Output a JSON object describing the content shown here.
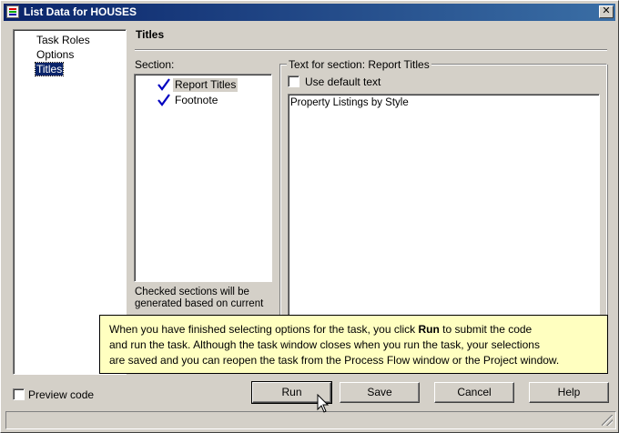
{
  "window": {
    "title": "List Data for HOUSES"
  },
  "nav": {
    "items": [
      {
        "label": "Task Roles",
        "selected": false
      },
      {
        "label": "Options",
        "selected": false
      },
      {
        "label": "Titles",
        "selected": true
      }
    ]
  },
  "panel": {
    "title": "Titles",
    "section_label": "Section:",
    "sections": [
      {
        "label": "Report Titles",
        "checked": true,
        "selected": true
      },
      {
        "label": "Footnote",
        "checked": true,
        "selected": false
      }
    ],
    "checked_note_lines": [
      "Checked sections will be",
      "generated based on current"
    ],
    "text_group_label": "Text for section: Report Titles",
    "use_default_label": "Use default text",
    "use_default_checked": false,
    "text_value": "Property Listings by Style"
  },
  "tooltip": {
    "line1_pre": "When you have finished selecting options for the task, you click ",
    "line1_bold": "Run",
    "line1_post": " to submit the code",
    "line2": "and run the task.  Although the task window closes when you run the task, your selections",
    "line3": "are saved and you can reopen the task from the Process Flow window or the Project window."
  },
  "footer": {
    "preview_label": "Preview code",
    "preview_checked": false,
    "buttons": {
      "run": "Run",
      "save": "Save",
      "cancel": "Cancel",
      "help": "Help"
    }
  },
  "icons": {
    "close": "close-icon",
    "app": "app-icon",
    "check": "check-icon",
    "cursor": "mouse-cursor-icon"
  },
  "colors": {
    "titlebar": "#0a246a",
    "tooltip_bg": "#ffffc0",
    "selection": "#0a246a",
    "check": "#0000c0"
  }
}
